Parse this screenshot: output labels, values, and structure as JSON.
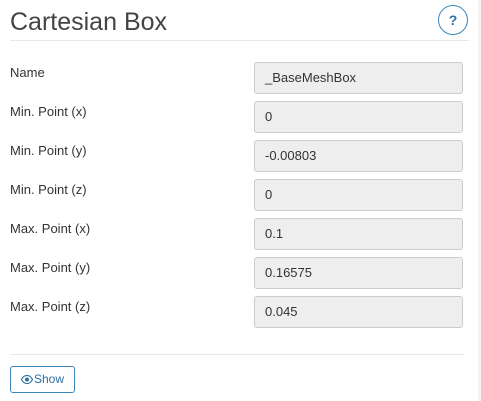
{
  "header": {
    "title": "Cartesian Box",
    "help_label": "?"
  },
  "fields": [
    {
      "label": "Name",
      "value": "_BaseMeshBox"
    },
    {
      "label": "Min. Point (x)",
      "value": "0"
    },
    {
      "label": "Min. Point (y)",
      "value": "-0.00803"
    },
    {
      "label": "Min. Point (z)",
      "value": "0"
    },
    {
      "label": "Max. Point (x)",
      "value": "0.1"
    },
    {
      "label": "Max. Point (y)",
      "value": "0.16575"
    },
    {
      "label": "Max. Point (z)",
      "value": "0.045"
    }
  ],
  "footer": {
    "show_label": "Show",
    "show_icon": "eye-icon"
  },
  "colors": {
    "accent": "#3d87b8",
    "input_background": "#eeeeee",
    "input_border": "#cccccc",
    "text": "#333333"
  }
}
